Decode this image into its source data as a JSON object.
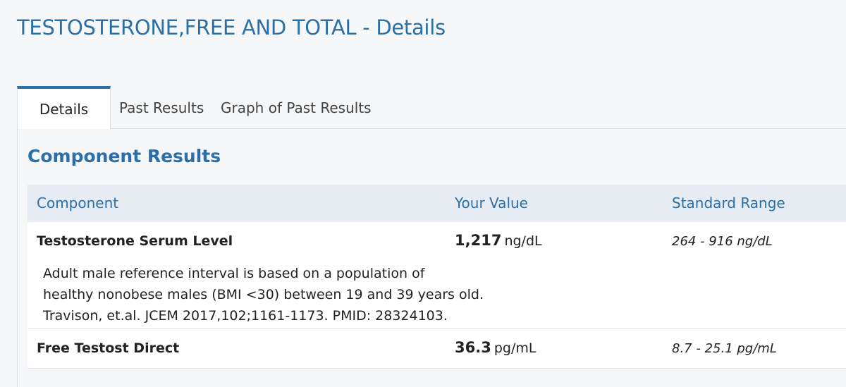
{
  "page": {
    "title": "TESTOSTERONE,FREE AND TOTAL - Details"
  },
  "tabs": [
    {
      "label": "Details",
      "active": true
    },
    {
      "label": "Past Results",
      "active": false
    },
    {
      "label": "Graph of Past Results",
      "active": false
    }
  ],
  "section": {
    "title": "Component Results"
  },
  "table": {
    "headers": {
      "component": "Component",
      "value": "Your Value",
      "range": "Standard Range"
    },
    "rows": [
      {
        "component": "Testosterone Serum Level",
        "value": "1,217",
        "unit": "ng/dL",
        "range": "264 - 916 ng/dL",
        "comment": [
          "Adult male reference interval is based on a population of",
          "healthy nonobese males (BMI <30) between 19 and 39 years old.",
          "Travison, et.al. JCEM 2017,102;1161-1173. PMID: 28324103."
        ]
      },
      {
        "component": "Free Testost Direct",
        "value": "36.3",
        "unit": "pg/mL",
        "range": "8.7 - 25.1 pg/mL"
      }
    ]
  },
  "colors": {
    "accent": "#2a6fa8",
    "header_bg": "#e6ecf2",
    "page_bg": "#f5f7f9"
  }
}
